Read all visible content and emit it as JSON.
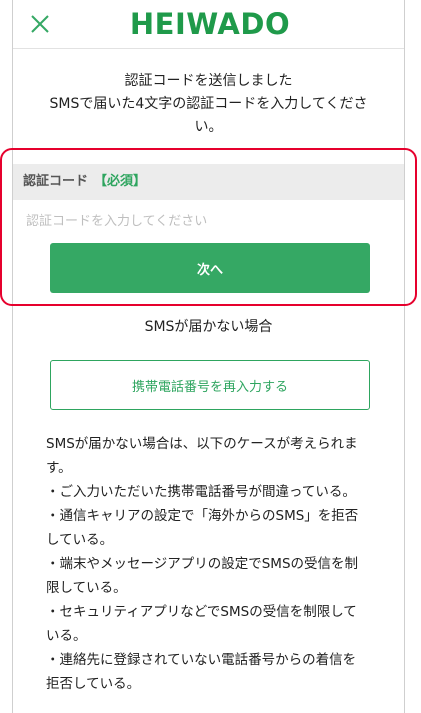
{
  "header": {
    "logo_text": "HEIWADO",
    "close_icon": "close-x-icon"
  },
  "message": {
    "line1": "認証コードを送信しました",
    "line2": "SMSで届いた4文字の認証コードを入力してくださ",
    "line3": "い。"
  },
  "form": {
    "label": "認証コード",
    "required": "【必須】",
    "placeholder": "認証コードを入力してください",
    "next_label": "次へ"
  },
  "sms_help": {
    "heading": "SMSが届かない場合",
    "reenter_label": "携帯電話番号を再入力する",
    "notes": [
      "SMSが届かない場合は、以下のケースが考えられま",
      "す。",
      "・ご入力いただいた携帯電話番号が間違っている。",
      "・通信キャリアの設定で「海外からのSMS」を拒否",
      "している。",
      "・端末やメッセージアプリの設定でSMSの受信を制",
      "限している。",
      "・セキュリティアプリなどでSMSの受信を制限して",
      "いる。",
      "・連絡先に登録されていない電話番号からの着信を",
      "拒否している。"
    ]
  },
  "colors": {
    "brand_green": "#35a864",
    "highlight_red": "#e6002d"
  }
}
